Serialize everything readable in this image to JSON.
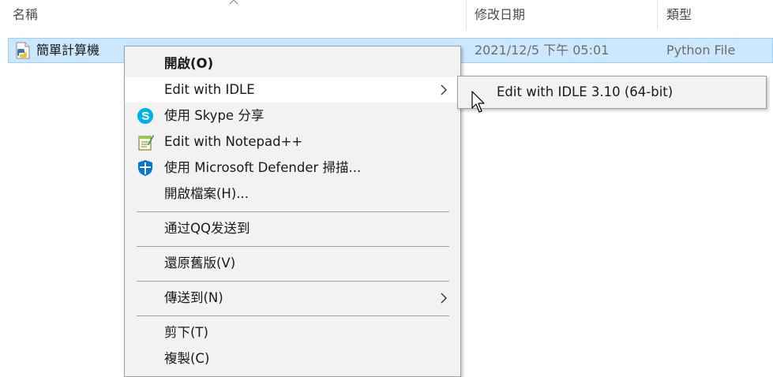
{
  "header": {
    "columns": [
      {
        "label": "名稱"
      },
      {
        "label": "修改日期"
      },
      {
        "label": "類型"
      }
    ]
  },
  "file_row": {
    "name": "簡單計算機",
    "modified": "2021/12/5 下午 05:01",
    "type": "Python File",
    "icon": "python-file-icon",
    "selected": true
  },
  "context_menu": {
    "items": [
      {
        "label": "開啟(O)",
        "bold": true
      },
      {
        "label": "Edit with IDLE",
        "highlighted": true,
        "has_submenu": true
      },
      {
        "label": "使用 Skype 分享",
        "icon": "skype-icon"
      },
      {
        "label": "Edit with Notepad++",
        "icon": "notepadpp-icon"
      },
      {
        "label": "使用 Microsoft Defender 掃描...",
        "icon": "defender-shield-icon"
      },
      {
        "label": "開啟檔案(H)..."
      },
      {
        "label": "通过QQ发送到"
      },
      {
        "label": "還原舊版(V)"
      },
      {
        "label": "傳送到(N)",
        "has_submenu": true
      },
      {
        "label": "剪下(T)"
      },
      {
        "label": "複製(C)"
      }
    ]
  },
  "submenu": {
    "items": [
      {
        "label": "Edit with IDLE 3.10 (64-bit)"
      }
    ]
  },
  "colors": {
    "selection_bg": "#cce8ff",
    "selection_border": "#99d1ff",
    "menu_bg": "#f2f2f2",
    "menu_highlight": "#ffffff",
    "skype_blue": "#00aff0",
    "defender_blue": "#0078d4"
  }
}
